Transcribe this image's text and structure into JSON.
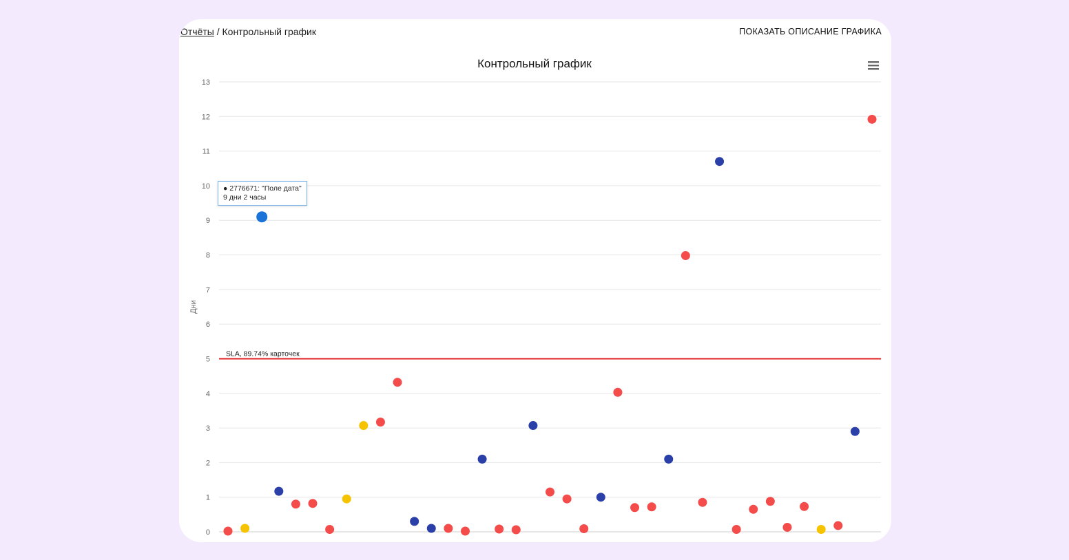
{
  "breadcrumb": {
    "link": "Отчёты",
    "separator": " / ",
    "current": "Контрольный график"
  },
  "header": {
    "show_description": "ПОКАЗАТЬ ОПИСАНИЕ ГРАФИКА"
  },
  "menu_icon": "hamburger-menu-icon",
  "tooltip": {
    "line1": "● 2776671: \"Поле дата\"",
    "line2": "9 дни 2 часы"
  },
  "colors": {
    "red": "#f44b4b",
    "blue": "#2a3fa7",
    "yellow": "#f5c300",
    "highlight": "#1a73d9",
    "sla": "#e02020"
  },
  "chart_data": {
    "type": "scatter",
    "title": "Контрольный график",
    "ylabel": "Дни",
    "xlabel": "",
    "ylim": [
      0,
      13
    ],
    "yticks": [
      0,
      1,
      2,
      3,
      4,
      5,
      6,
      7,
      8,
      9,
      10,
      11,
      12,
      13
    ],
    "grid": true,
    "sla": {
      "value": 5,
      "label": "SLA, 89.74% карточек"
    },
    "points": [
      {
        "y": 0.02,
        "color": "red"
      },
      {
        "y": 0.1,
        "color": "yellow"
      },
      {
        "y": 9.1,
        "color": "highlight"
      },
      {
        "y": 1.17,
        "color": "blue"
      },
      {
        "y": 0.8,
        "color": "red"
      },
      {
        "y": 0.82,
        "color": "red"
      },
      {
        "y": 0.07,
        "color": "red"
      },
      {
        "y": 0.95,
        "color": "yellow"
      },
      {
        "y": 3.07,
        "color": "yellow"
      },
      {
        "y": 3.17,
        "color": "red"
      },
      {
        "y": 4.32,
        "color": "red"
      },
      {
        "y": 0.3,
        "color": "blue"
      },
      {
        "y": 0.1,
        "color": "blue"
      },
      {
        "y": 0.1,
        "color": "red"
      },
      {
        "y": 0.02,
        "color": "red"
      },
      {
        "y": 2.1,
        "color": "blue"
      },
      {
        "y": 0.08,
        "color": "red"
      },
      {
        "y": 0.06,
        "color": "red"
      },
      {
        "y": 3.07,
        "color": "blue"
      },
      {
        "y": 1.15,
        "color": "red"
      },
      {
        "y": 0.95,
        "color": "red"
      },
      {
        "y": 0.09,
        "color": "red"
      },
      {
        "y": 1.0,
        "color": "blue"
      },
      {
        "y": 4.03,
        "color": "red"
      },
      {
        "y": 0.7,
        "color": "red"
      },
      {
        "y": 0.72,
        "color": "red"
      },
      {
        "y": 2.1,
        "color": "blue"
      },
      {
        "y": 7.98,
        "color": "red"
      },
      {
        "y": 0.85,
        "color": "red"
      },
      {
        "y": 10.7,
        "color": "blue"
      },
      {
        "y": 0.07,
        "color": "red"
      },
      {
        "y": 0.65,
        "color": "red"
      },
      {
        "y": 0.88,
        "color": "red"
      },
      {
        "y": 0.13,
        "color": "red"
      },
      {
        "y": 0.73,
        "color": "red"
      },
      {
        "y": 0.07,
        "color": "yellow"
      },
      {
        "y": 0.18,
        "color": "red"
      },
      {
        "y": 2.9,
        "color": "blue"
      },
      {
        "y": 11.92,
        "color": "red"
      }
    ]
  }
}
